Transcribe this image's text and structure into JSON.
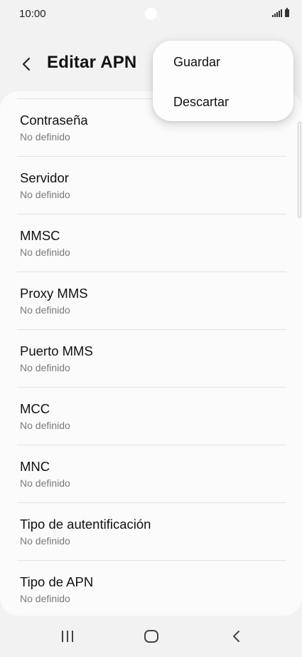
{
  "status_bar": {
    "time": "10:00"
  },
  "header": {
    "title": "Editar APN",
    "back_icon": "chevron-left-icon"
  },
  "menu": {
    "items": [
      {
        "label": "Guardar"
      },
      {
        "label": "Descartar"
      }
    ]
  },
  "settings": [
    {
      "title": "Contraseña",
      "value": "No definido"
    },
    {
      "title": "Servidor",
      "value": "No definido"
    },
    {
      "title": "MMSC",
      "value": "No definido"
    },
    {
      "title": "Proxy MMS",
      "value": "No definido"
    },
    {
      "title": "Puerto MMS",
      "value": "No definido"
    },
    {
      "title": "MCC",
      "value": "No definido"
    },
    {
      "title": "MNC",
      "value": "No definido"
    },
    {
      "title": "Tipo de autentificación",
      "value": "No definido"
    },
    {
      "title": "Tipo de APN",
      "value": "No definido"
    }
  ],
  "nav_bar": {
    "recents_icon": "recents-icon",
    "home_icon": "home-icon",
    "back_icon": "back-icon"
  }
}
